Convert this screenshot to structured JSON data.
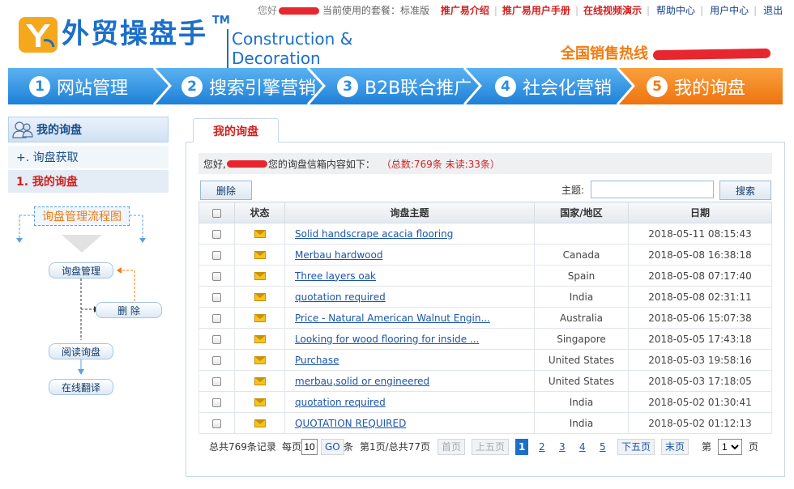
{
  "topbar": {
    "greeting": "您好",
    "package_text": "当前使用的套餐：标准版",
    "links_red": [
      "推广易介绍",
      "推广易用户手册",
      "在线视频演示"
    ],
    "links_blue": [
      "帮助中心",
      "用户中心",
      "退出"
    ]
  },
  "logo": {
    "cn": "外贸操盘手",
    "tm": "TM",
    "en": "Construction & Decoration"
  },
  "hotline": {
    "label": "全国销售热线"
  },
  "nav": {
    "steps": [
      {
        "num": "1",
        "label": "网站管理"
      },
      {
        "num": "2",
        "label": "搜索引擎营销"
      },
      {
        "num": "3",
        "label": "B2B联合推广"
      },
      {
        "num": "4",
        "label": "社会化营销"
      },
      {
        "num": "5",
        "label": "我的询盘"
      }
    ],
    "active_color": "#f07b10",
    "inactive_color": "#2c8ddf"
  },
  "sidebar": {
    "title": "我的询盘",
    "items": [
      "+. 询盘获取",
      "1. 我的询盘"
    ],
    "flow": {
      "title": "询盘管理流程图",
      "boxes": [
        "询盘管理",
        "删 除",
        "阅读询盘",
        "在线翻译"
      ]
    }
  },
  "main": {
    "tab": "我的询盘",
    "info_prefix": "您好,",
    "info_suffix": "您的询盘信箱内容如下：",
    "stats": "（总数:769条   未读:33条）",
    "delete_label": "删除",
    "subject_label": "主题:",
    "subject_value": "",
    "search_label": "搜索",
    "columns": [
      "",
      "状态",
      "询盘主题",
      "国家/地区",
      "日期"
    ],
    "rows": [
      {
        "subject": "Solid handscrape acacia flooring",
        "country": "",
        "date": "2018-05-11 08:15:43"
      },
      {
        "subject": "Merbau hardwood",
        "country": "Canada",
        "date": "2018-05-08 16:38:18"
      },
      {
        "subject": "Three layers oak",
        "country": "Spain",
        "date": "2018-05-08 07:17:40"
      },
      {
        "subject": "quotation required",
        "country": "India",
        "date": "2018-05-08 02:31:11"
      },
      {
        "subject": "Price - Natural American Walnut Engin...",
        "country": "Australia",
        "date": "2018-05-06 15:07:38"
      },
      {
        "subject": "Looking for wood flooring for inside ...",
        "country": "Singapore",
        "date": "2018-05-05 17:43:18"
      },
      {
        "subject": "Purchase",
        "country": "United States",
        "date": "2018-05-03 19:58:16"
      },
      {
        "subject": "merbau,solid or engineered",
        "country": "United States",
        "date": "2018-05-03 17:18:05"
      },
      {
        "subject": "quotation required",
        "country": "India",
        "date": "2018-05-02 01:30:41"
      },
      {
        "subject": "QUOTATION REQUIRED",
        "country": "India",
        "date": "2018-05-02 01:12:13"
      }
    ]
  },
  "pager": {
    "total": "总共769条记录",
    "per_page_label": "每页",
    "per_page_value": "10",
    "go_label": "GO",
    "unit": "条",
    "page_info": "第1页/总共77页",
    "first": "首页",
    "prev5": "上五页",
    "pages": [
      "1",
      "2",
      "3",
      "4",
      "5"
    ],
    "next5": "下五页",
    "last": "末页",
    "jump_prefix": "第",
    "jump_value": "1",
    "jump_suffix": "页"
  }
}
